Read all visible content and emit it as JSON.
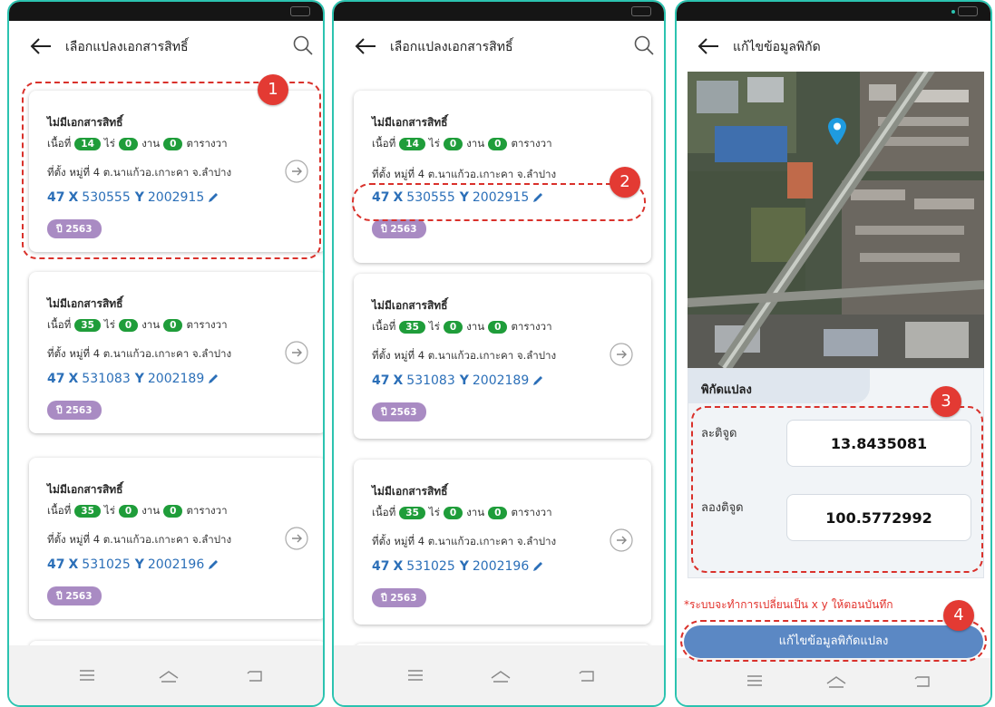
{
  "screens": [
    {
      "title": "เลือกแปลงเอกสารสิทธิ์"
    },
    {
      "title": "เลือกแปลงเอกสารสิทธิ์"
    },
    {
      "title": "แก้ไขข้อมูลพิกัด"
    }
  ],
  "cards": [
    {
      "name": "ไม่มีเอกสารสิทธิ์",
      "area_label": "เนื้อที่",
      "rai": "14",
      "rai_unit": "ไร่",
      "ngan": "0",
      "ngan_unit": "งาน",
      "wa": "0",
      "wa_unit": "ตารางวา",
      "location": "ที่ตั้ง หมู่ที่ 4 ต.นาแก้วอ.เกาะคา จ.ลำปาง",
      "zone": "47",
      "x_label": "X",
      "x": "530555",
      "y_label": "Y",
      "y": "2002915",
      "year": "ปี 2563"
    },
    {
      "name": "ไม่มีเอกสารสิทธิ์",
      "area_label": "เนื้อที่",
      "rai": "35",
      "rai_unit": "ไร่",
      "ngan": "0",
      "ngan_unit": "งาน",
      "wa": "0",
      "wa_unit": "ตารางวา",
      "location": "ที่ตั้ง หมู่ที่ 4 ต.นาแก้วอ.เกาะคา จ.ลำปาง",
      "zone": "47",
      "x_label": "X",
      "x": "531083",
      "y_label": "Y",
      "y": "2002189",
      "year": "ปี 2563"
    },
    {
      "name": "ไม่มีเอกสารสิทธิ์",
      "area_label": "เนื้อที่",
      "rai": "35",
      "rai_unit": "ไร่",
      "ngan": "0",
      "ngan_unit": "งาน",
      "wa": "0",
      "wa_unit": "ตารางวา",
      "location": "ที่ตั้ง หมู่ที่ 4 ต.นาแก้วอ.เกาะคา จ.ลำปาง",
      "zone": "47",
      "x_label": "X",
      "x": "531025",
      "y_label": "Y",
      "y": "2002196",
      "year": "ปี 2563"
    }
  ],
  "edit": {
    "panel_title": "พิกัดแปลง",
    "lat_label": "ละติจูด",
    "lat_value": "13.8435081",
    "lng_label": "ลองติจูด",
    "lng_value": "100.5772992",
    "note": "*ระบบจะทำการเปลี่ยนเป็น x y ให้ตอนบันทึก",
    "save_label": "แก้ไขข้อมูลพิกัดแปลง"
  },
  "markers": [
    "1",
    "2",
    "3",
    "4"
  ],
  "colors": {
    "frame": "#2cc3b0",
    "pill": "#1f9d3a",
    "coord": "#2b6fb8",
    "year": "#a98bc3",
    "marker": "#e33a33",
    "button": "#5b88c4",
    "note": "#e2312b"
  },
  "icons": [
    "back-arrow-icon",
    "search-icon",
    "chevron-right-circle-icon",
    "pencil-icon",
    "menu-icon",
    "home-icon",
    "back-nav-icon",
    "map-pin-icon"
  ]
}
